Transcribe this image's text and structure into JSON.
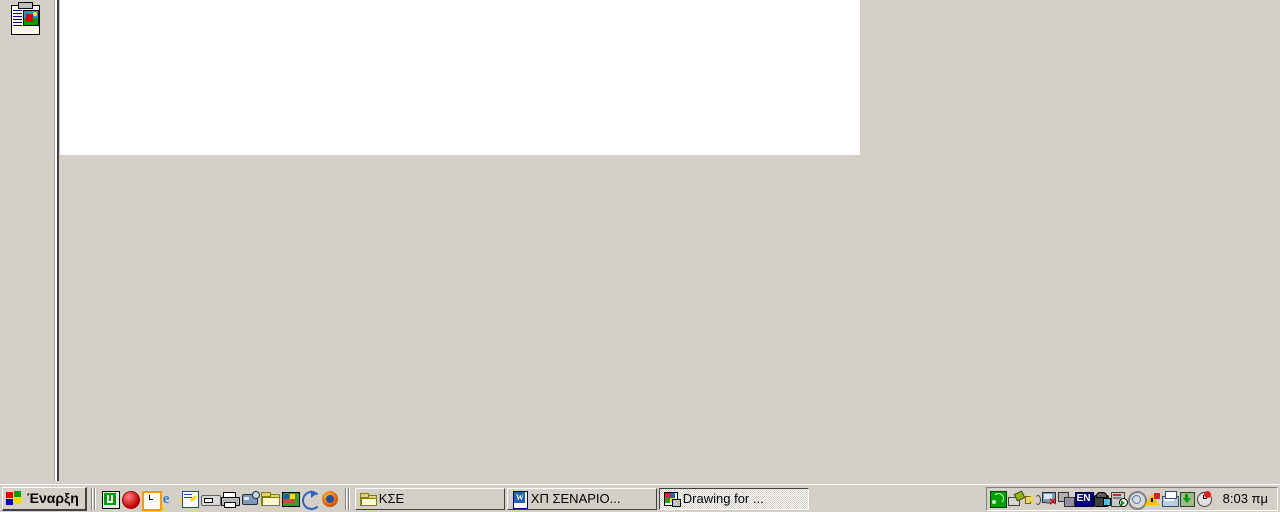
{
  "desktop": {
    "background_color": "#d4d0c8",
    "icons": [
      {
        "name": "clipboard-image-icon",
        "label": ""
      }
    ],
    "canvas": {
      "background_color": "#ffffff",
      "content": ""
    }
  },
  "taskbar": {
    "start": {
      "label": "Έναρξη",
      "icon": "windows-flag-icon"
    },
    "quick_launch": {
      "icons": [
        {
          "name": "mu-editor-icon",
          "color": "#00a000"
        },
        {
          "name": "red-sphere-icon",
          "color": "#d03030"
        },
        {
          "name": "clock-icon",
          "color": "#ff9900"
        },
        {
          "name": "internet-explorer-icon",
          "color": "#2a7fd4"
        },
        {
          "name": "notepad-edit-icon",
          "color": "#2040c0"
        },
        {
          "name": "floppy-media-icon",
          "color": "#d8d8d8"
        },
        {
          "name": "printer-icon",
          "color": "#c0c0c0"
        },
        {
          "name": "network-drive-icon",
          "color": "#7090b0"
        },
        {
          "name": "open-folder-icon",
          "color": "#e8d070"
        },
        {
          "name": "paint-desktop-icon",
          "color": "#30a030"
        },
        {
          "name": "sync-refresh-icon",
          "color": "#3060c0"
        },
        {
          "name": "firefox-icon",
          "color": "#e06000"
        }
      ]
    },
    "task_buttons": [
      {
        "name": "task-button-folder",
        "label": "ΚΣΕ",
        "icon": "folder-icon",
        "active": false
      },
      {
        "name": "task-button-word",
        "label": "ΧΠ  ΣΕΝΑΡΙΟ...",
        "icon": "word-document-icon",
        "active": false
      },
      {
        "name": "task-button-drawing",
        "label": "Drawing for ...",
        "icon": "drawing-app-icon",
        "active": true
      }
    ],
    "tray": {
      "icons": [
        {
          "name": "wireless-signal-icon",
          "color": "#00c000"
        },
        {
          "name": "network-cable-icon",
          "color": "#90b020"
        },
        {
          "name": "volume-speaker-icon",
          "color": "#e8d870"
        },
        {
          "name": "monitor-disconnected-icon",
          "color": "#7090b0"
        },
        {
          "name": "network-connection-icon",
          "color": "#909090"
        },
        {
          "name": "keyboard-language-icon",
          "label": "EN",
          "color": "#000080"
        },
        {
          "name": "fax-modem-icon",
          "color": "#404040"
        },
        {
          "name": "media-player-icon",
          "color": "#b0b0b0"
        },
        {
          "name": "antivirus-shield-icon",
          "color": "#909090"
        },
        {
          "name": "warning-triangle-icon",
          "color": "#ffc000"
        },
        {
          "name": "scanner-icon",
          "color": "#80c0e0"
        },
        {
          "name": "download-arrow-icon",
          "color": "#408040"
        },
        {
          "name": "alarm-clock-icon",
          "color": "#d0d0d0"
        }
      ],
      "clock": "8:03 πμ"
    }
  }
}
